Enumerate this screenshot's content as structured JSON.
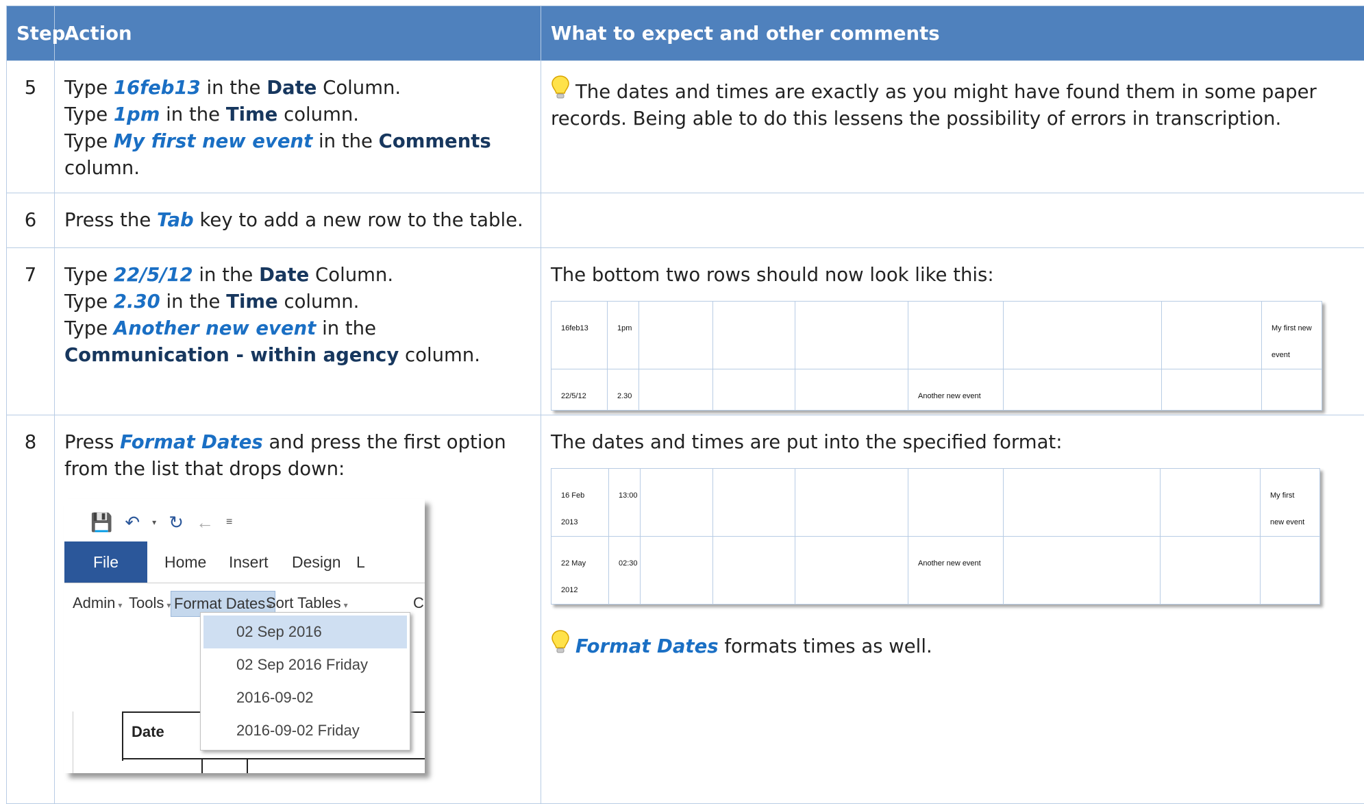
{
  "header": {
    "step": "Step",
    "action": "Action",
    "comments": "What to expect and other comments"
  },
  "rows": [
    {
      "step": "5",
      "action": [
        {
          "pre": "Type ",
          "key": "16feb13",
          "mid": "  in the ",
          "field": "Date",
          "post": " Column."
        },
        {
          "pre": "Type ",
          "key": "1pm",
          "mid": " in the ",
          "field": "Time",
          "post": " column."
        },
        {
          "pre": "Type ",
          "key": "My first new event",
          "mid": " in the ",
          "field": "Comments",
          "post": " column."
        }
      ],
      "comment": "The dates and times are exactly as you might have found them in some paper records. Being able to do this lessens the possibility of errors in transcription."
    },
    {
      "step": "6",
      "action_pre": "Press the ",
      "action_key": "Tab",
      "action_post": " key to add a new row to the table."
    },
    {
      "step": "7",
      "action": [
        {
          "pre": "Type ",
          "key": "22/5/12",
          "mid": "  in the ",
          "field": "Date",
          "post": " Column."
        },
        {
          "pre": "Type ",
          "key": "2.30",
          "mid": "  in the ",
          "field": "Time",
          "post": " column."
        },
        {
          "pre": "Type ",
          "key": "Another new event",
          "mid": " in the ",
          "field": "Communication - within agency",
          "post": " column."
        }
      ],
      "comment": "The bottom two rows should now look like this:",
      "table": [
        [
          "16feb13",
          "1pm",
          "",
          "",
          "",
          "",
          "",
          "",
          "My first new event"
        ],
        [
          "22/5/12",
          "2.30",
          "",
          "",
          "",
          "Another new event",
          "",
          "",
          ""
        ]
      ]
    },
    {
      "step": "8",
      "action_pre": "Press ",
      "action_key": "Format Dates",
      "action_post": "  and press the first option from the list that drops down:",
      "comment": "The dates and times are put into the specified format:",
      "table": [
        [
          "16 Feb 2013",
          "13:00",
          "",
          "",
          "",
          "",
          "",
          "",
          "My first new event"
        ],
        [
          "22 May 2012",
          "02:30",
          "",
          "",
          "",
          "Another new event",
          "",
          "",
          ""
        ]
      ],
      "tip_key": "Format Dates",
      "tip_text": "  formats times as well."
    }
  ],
  "screenshot": {
    "ribbon_tabs": [
      "File",
      "Home",
      "Insert",
      "Design",
      "L"
    ],
    "menu": [
      "Admin",
      "Tools",
      "Format Dates",
      "Sort Tables",
      "C"
    ],
    "dropdown": [
      "02 Sep 2016",
      "02 Sep 2016 Friday",
      "2016-09-02",
      "2016-09-02 Friday"
    ],
    "doc_header": "Date"
  },
  "colors": {
    "header_bg": "#4f81bd",
    "keyword": "#1a6fc4",
    "field": "#17375e",
    "file_tab": "#2b579a"
  }
}
